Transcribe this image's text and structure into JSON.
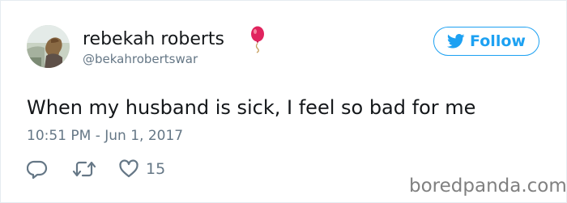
{
  "user": {
    "display_name": "rebekah roberts",
    "handle": "@bekahrobertswar",
    "name_emoji": "balloon-icon"
  },
  "follow_button": {
    "label": "Follow",
    "icon": "twitter-bird-icon"
  },
  "tweet": {
    "text": "When my husband is sick, I feel so bad for me",
    "timestamp": "10:51 PM - Jun 1, 2017"
  },
  "actions": {
    "reply_icon": "reply-icon",
    "retweet_icon": "retweet-icon",
    "like_icon": "heart-icon",
    "like_count": "15"
  },
  "watermark": "boredpanda.com",
  "colors": {
    "accent": "#1da1f2",
    "muted_text": "#657786",
    "primary_text": "#14171a",
    "balloon": "#e0245e"
  }
}
